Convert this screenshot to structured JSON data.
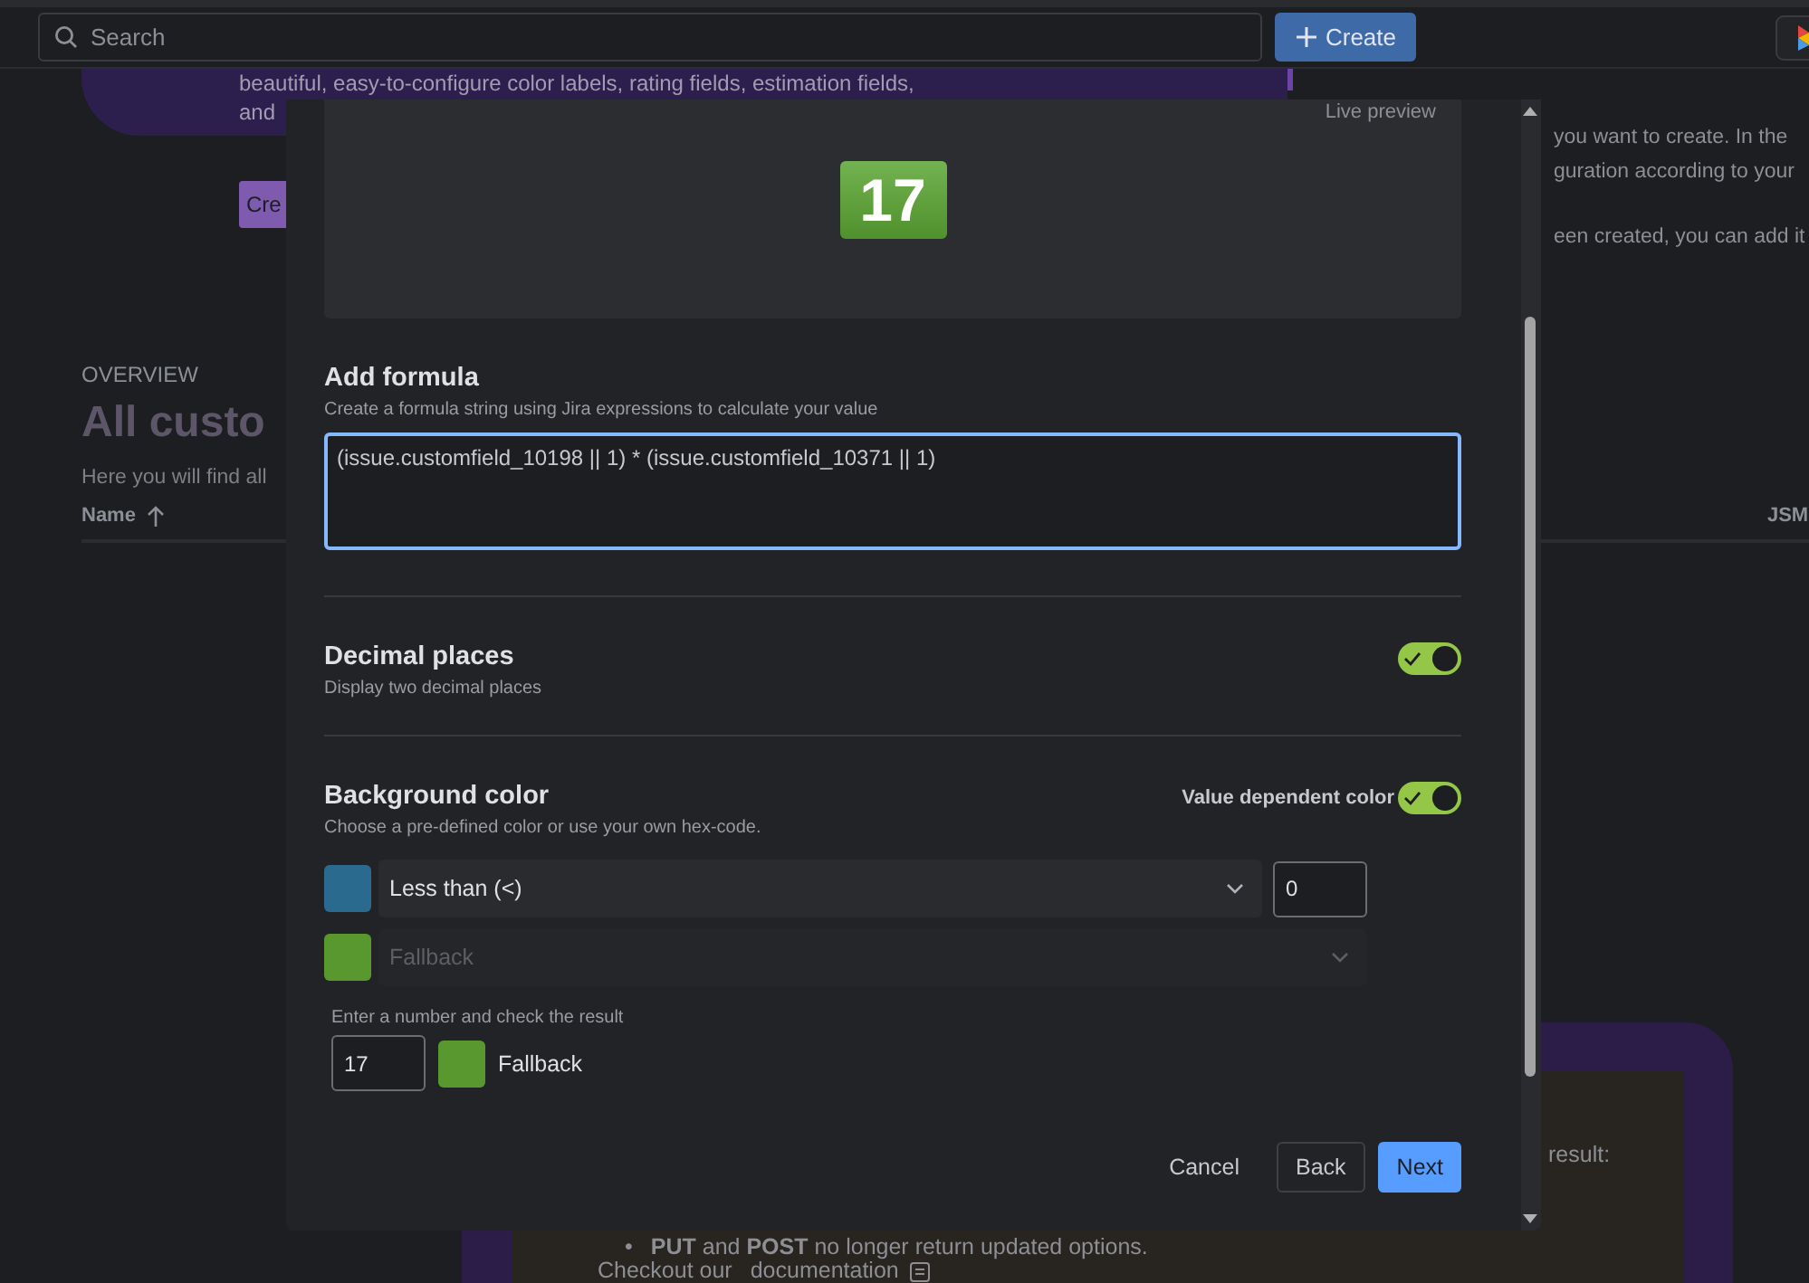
{
  "topbar": {
    "search": {
      "placeholder": "Search"
    },
    "create_button": "Create"
  },
  "background": {
    "banner_lines": [
      "beautiful, easy-to-configure color labels, rating fields, estimation fields,",
      "and"
    ],
    "banner_button": "Cre",
    "side_lines": [
      "you want to create. In the",
      "guration according to your",
      "een created, you can add it"
    ],
    "overview_label": "OVERVIEW",
    "heading": "All custo",
    "intro": "Here you will find all",
    "columns": [
      {
        "label": "Name",
        "sorted": true
      },
      {
        "label": "JSM",
        "sorted": false
      }
    ],
    "bottom_panel": {
      "result_text": "result:",
      "bullet_marker": "•",
      "bullet": "**PUT** and **POST** no longer return updated options.",
      "checkout": "Checkout our",
      "link": "documentation"
    }
  },
  "dialog": {
    "preview": {
      "label": "Live preview",
      "value": "17",
      "color": "#5aa532"
    },
    "formula": {
      "title": "Add formula",
      "description": "Create a formula string using Jira expressions to calculate your value",
      "value": "(issue.customfield_10198 || 1) * (issue.customfield_10371 || 1)"
    },
    "decimal": {
      "title": "Decimal places",
      "description": "Display two decimal places",
      "on": true
    },
    "background_color": {
      "title": "Background color",
      "description": "Choose a pre-defined color or use your own hex-code.",
      "toggle_label": "Value dependent color",
      "on": true,
      "rules": [
        {
          "color": "#2b6a8f",
          "operator": "Less than (<)",
          "value": "0",
          "disabled": false
        },
        {
          "color": "#58982f",
          "operator": "Fallback",
          "disabled": true
        }
      ],
      "test": {
        "label": "Enter a number and check the result",
        "value": "17",
        "color": "#58982f",
        "result": "Fallback"
      }
    },
    "buttons": [
      {
        "label": "Cancel",
        "kind": "subtle"
      },
      {
        "label": "Back",
        "kind": "default"
      },
      {
        "label": "Next",
        "kind": "primary"
      }
    ]
  }
}
